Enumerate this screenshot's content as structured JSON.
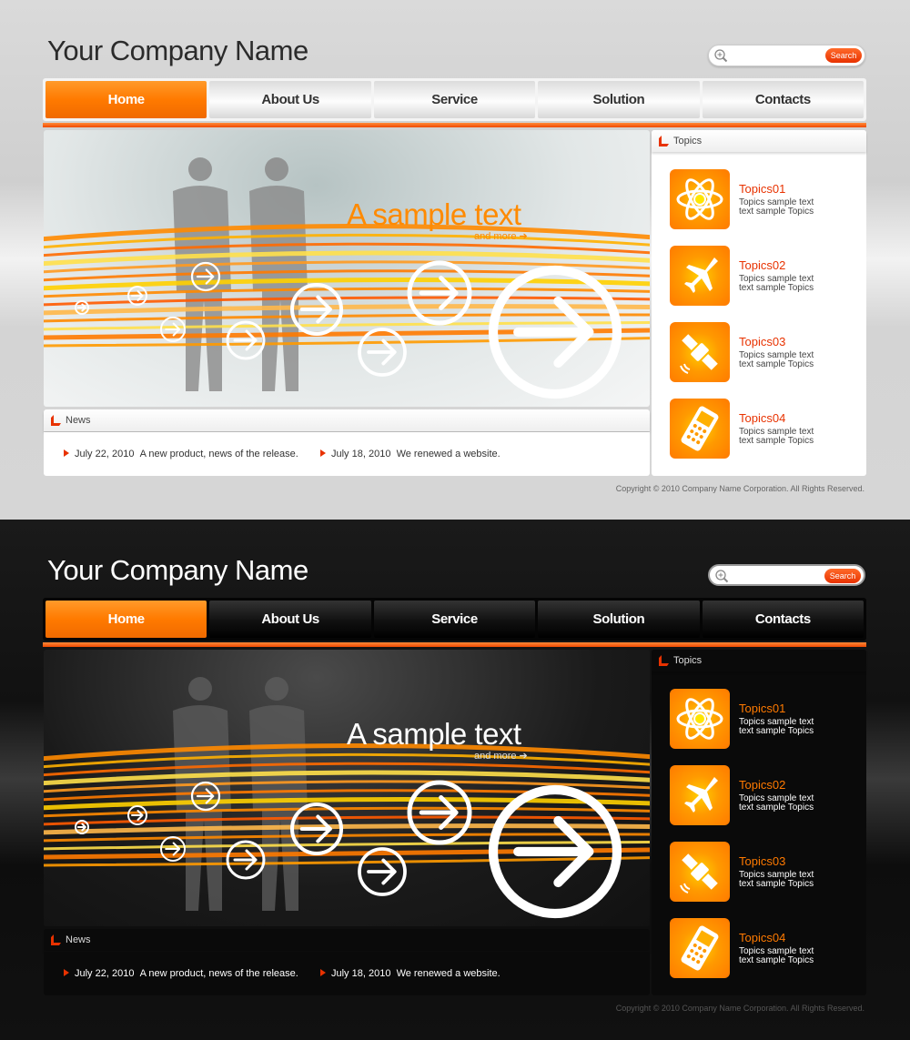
{
  "header": {
    "company_name": "Your Company Name",
    "search_placeholder": "",
    "search_label": "Search"
  },
  "nav": {
    "items": [
      {
        "label": "Home",
        "active": true
      },
      {
        "label": "About Us"
      },
      {
        "label": "Service"
      },
      {
        "label": "Solution"
      },
      {
        "label": "Contacts"
      }
    ]
  },
  "hero": {
    "headline": "A sample text",
    "more_link": "and more"
  },
  "news": {
    "title": "News",
    "items": [
      {
        "date": "July 22, 2010",
        "text": "A new product, news of the release."
      },
      {
        "date": "July 18, 2010",
        "text": "We renewed a website."
      }
    ]
  },
  "topics": {
    "title": "Topics",
    "items": [
      {
        "title": "Topics01",
        "line1": "Topics sample text",
        "line2": "text sample Topics",
        "icon": "atom-icon"
      },
      {
        "title": "Topics02",
        "line1": "Topics sample text",
        "line2": "text sample Topics",
        "icon": "airplane-icon"
      },
      {
        "title": "Topics03",
        "line1": "Topics sample text",
        "line2": "text sample Topics",
        "icon": "satellite-icon"
      },
      {
        "title": "Topics04",
        "line1": "Topics sample text",
        "line2": "text sample Topics",
        "icon": "mobile-phone-icon"
      }
    ]
  },
  "footer": {
    "copyright": "Copyright © 2010 Company Name Corporation. All Rights Reserved."
  },
  "variants": [
    "light",
    "dark"
  ],
  "colors": {
    "accent": "#ff7a00",
    "accent_red": "#e83200",
    "light_bg": "#d4d4d4",
    "dark_bg": "#111111"
  }
}
